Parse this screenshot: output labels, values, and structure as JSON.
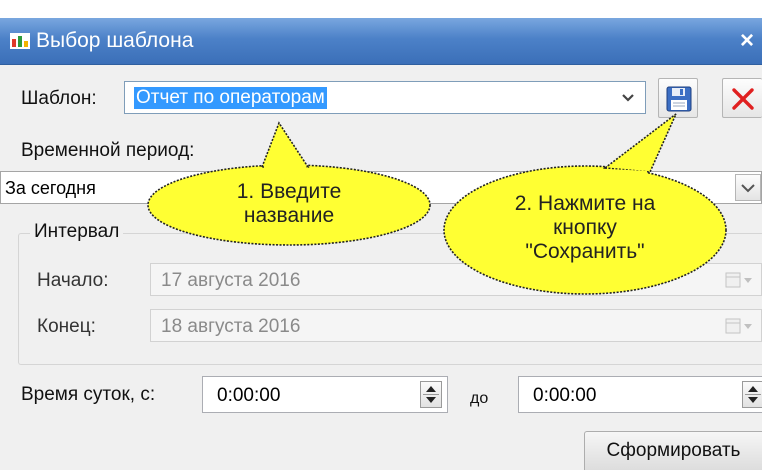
{
  "window": {
    "title": "Выбор шаблона",
    "close_glyph": "×",
    "icon": "app-chart-icon"
  },
  "template": {
    "label": "Шаблон:",
    "value": "Отчет по операторам",
    "save_icon": "floppy-disk-icon",
    "delete_icon": "red-x-icon"
  },
  "period": {
    "label": "Временной период:",
    "value": "За сегодня"
  },
  "interval": {
    "legend": "Интервал",
    "start_label": "Начало:",
    "start_value": "17  августа  2016",
    "end_label": "Конец:",
    "end_value": "18  августа  2016"
  },
  "time_of_day": {
    "label": "Время суток, с:",
    "from_value": "0:00:00",
    "to_label": "до",
    "to_value": "0:00:00"
  },
  "actions": {
    "generate_label": "Сформировать"
  },
  "callouts": [
    {
      "line1": "1. Введите",
      "line2": "название"
    },
    {
      "line1": "2. Нажмите на",
      "line2": "кнопку",
      "line3": "\"Сохранить\""
    }
  ],
  "colors": {
    "titlebar": "#4c81c8",
    "selection": "#3399ff",
    "callout_fill": "#ffff33",
    "delete_red": "#e02020"
  }
}
